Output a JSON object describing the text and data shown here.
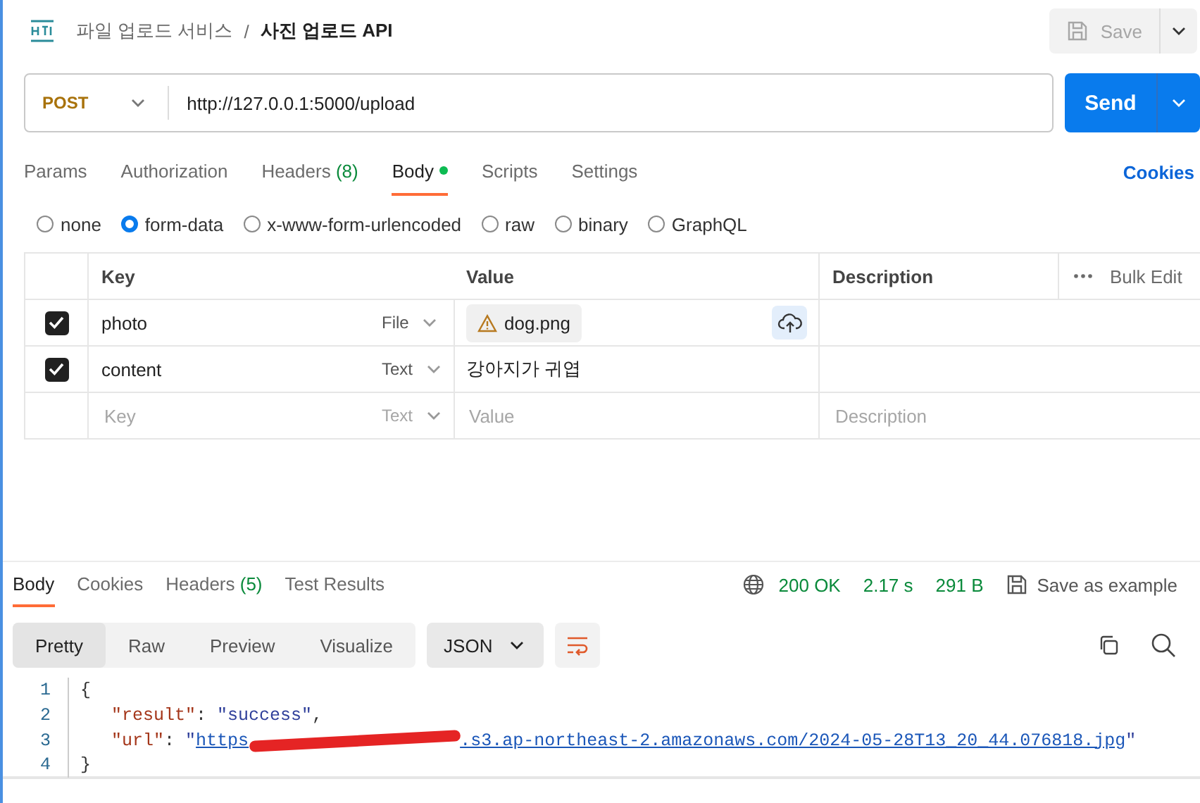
{
  "header": {
    "collection": "파일 업로드 서비스",
    "separator": "/",
    "title": "사진 업로드 API",
    "save": {
      "label": "Save",
      "disabled": true
    }
  },
  "request": {
    "method": "POST",
    "url": "http://127.0.0.1:5000/upload",
    "send": "Send"
  },
  "tabs": [
    {
      "label": "Params",
      "dot": false,
      "selected": false
    },
    {
      "label": "Authorization",
      "dot": false,
      "selected": false
    },
    {
      "label": "Headers",
      "count": "(8)",
      "dot": false,
      "selected": false
    },
    {
      "label": "Body",
      "dot": true,
      "selected": true
    },
    {
      "label": "Scripts",
      "dot": false,
      "selected": false
    },
    {
      "label": "Settings",
      "dot": false,
      "selected": false
    }
  ],
  "cookies": "Cookies",
  "body_modes": [
    {
      "label": "none",
      "selected": false
    },
    {
      "label": "form-data",
      "selected": true
    },
    {
      "label": "x-www-form-urlencoded",
      "selected": false
    },
    {
      "label": "raw",
      "selected": false
    },
    {
      "label": "binary",
      "selected": false
    },
    {
      "label": "GraphQL",
      "selected": false
    }
  ],
  "table": {
    "columns": [
      "Key",
      "Value",
      "Description"
    ],
    "bulk_edit": "Bulk Edit",
    "rows": [
      {
        "checked": true,
        "key": "photo",
        "type": "File",
        "kind": "file",
        "value": "dog.png"
      },
      {
        "checked": true,
        "key": "content",
        "type": "Text",
        "kind": "text",
        "value": "강아지가 귀엽"
      }
    ],
    "new_row": {
      "key_placeholder": "Key",
      "type": "Text",
      "value_placeholder": "Value",
      "description_placeholder": "Description"
    }
  },
  "response": {
    "tabs": [
      {
        "label": "Body",
        "selected": true
      },
      {
        "label": "Cookies",
        "selected": false
      },
      {
        "label": "Headers",
        "count": "(5)",
        "selected": false
      },
      {
        "label": "Test Results",
        "selected": false
      }
    ],
    "status": "200 OK",
    "time": "2.17 s",
    "size": "291 B",
    "save_example": "Save as example",
    "view_modes": [
      {
        "label": "Pretty",
        "selected": true
      },
      {
        "label": "Raw",
        "selected": false
      },
      {
        "label": "Preview",
        "selected": false
      },
      {
        "label": "Visualize",
        "selected": false
      }
    ],
    "format": "JSON",
    "lines": [
      {
        "number": "1",
        "indented": false,
        "tokens": [
          {
            "kind": "punct",
            "text": "{"
          }
        ]
      },
      {
        "number": "2",
        "indented": true,
        "tokens": [
          {
            "kind": "key",
            "text": "\"result\""
          },
          {
            "kind": "punct",
            "text": ": "
          },
          {
            "kind": "string",
            "text": "\"success\""
          },
          {
            "kind": "punct",
            "text": ","
          }
        ]
      },
      {
        "number": "3",
        "indented": true,
        "tokens": [
          {
            "kind": "key",
            "text": "\"url\""
          },
          {
            "kind": "punct",
            "text": ": "
          },
          {
            "kind": "string",
            "text": "\""
          },
          {
            "kind": "link",
            "text": "https"
          },
          {
            "kind": "redaction"
          },
          {
            "kind": "link",
            "text": ".s3.ap-northeast-2.amazonaws.com/2024-05-28T13_20_44.076818.jpg"
          },
          {
            "kind": "string",
            "text": "\""
          }
        ]
      },
      {
        "number": "4",
        "indented": false,
        "tokens": [
          {
            "kind": "punct",
            "text": "}"
          }
        ]
      }
    ]
  }
}
